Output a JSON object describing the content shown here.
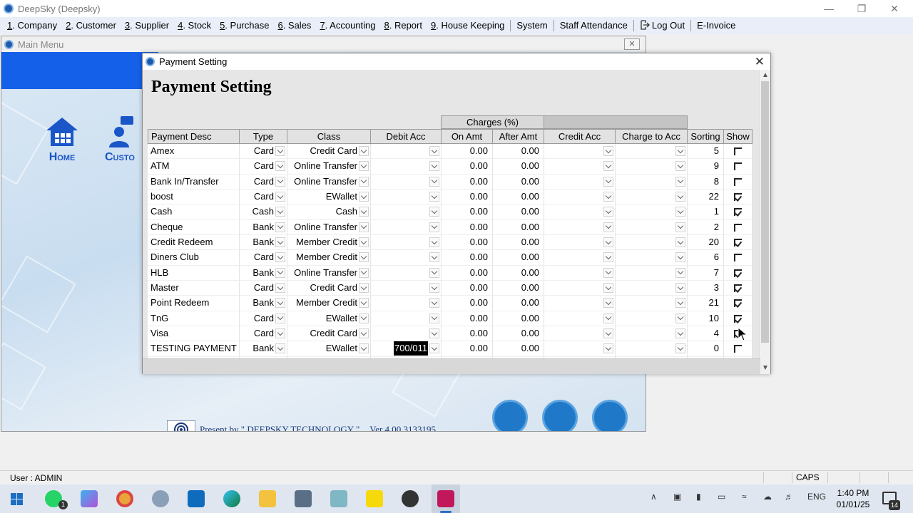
{
  "app": {
    "title": "DeepSky (Deepsky)"
  },
  "menu": {
    "items": [
      {
        "num": "1",
        "label": ". Company"
      },
      {
        "num": "2",
        "label": ". Customer"
      },
      {
        "num": "3",
        "label": ". Supplier"
      },
      {
        "num": "4",
        "label": ". Stock"
      },
      {
        "num": "5",
        "label": ". Purchase"
      },
      {
        "num": "6",
        "label": ". Sales"
      },
      {
        "num": "7",
        "label": ". Accounting"
      },
      {
        "num": "8",
        "label": ". Report"
      },
      {
        "num": "9",
        "label": ". House Keeping"
      }
    ],
    "system": "System",
    "staff_attendance": "Staff Attendance",
    "logout": "Log Out",
    "einvoice": "E-Invoice"
  },
  "main_menu": {
    "title": "Main Menu",
    "home_label": "Home",
    "customer_label": "Custo",
    "present_by": "Present by \" DEEPSKY TECHNOLOGY \"",
    "version": "Ver 4.00.3133195"
  },
  "payment_window": {
    "title": "Payment Setting",
    "heading": "Payment Setting",
    "group_header": "Charges (%)",
    "columns": [
      "Payment Desc",
      "Type",
      "Class",
      "Debit Acc",
      "On Amt",
      "After Amt",
      "Credit Acc",
      "Charge to Acc",
      "Sorting",
      "Show"
    ],
    "rows": [
      {
        "desc": "Amex",
        "type": "Card",
        "class": "Credit Card",
        "debit": "",
        "on_amt": "0.00",
        "after_amt": "0.00",
        "sorting": "5",
        "show": false
      },
      {
        "desc": "ATM",
        "type": "Card",
        "class": "Online Transfer",
        "debit": "",
        "on_amt": "0.00",
        "after_amt": "0.00",
        "sorting": "9",
        "show": false
      },
      {
        "desc": "Bank In/Transfer",
        "type": "Card",
        "class": "Online Transfer",
        "debit": "",
        "on_amt": "0.00",
        "after_amt": "0.00",
        "sorting": "8",
        "show": false
      },
      {
        "desc": "boost",
        "type": "Card",
        "class": "EWallet",
        "debit": "",
        "on_amt": "0.00",
        "after_amt": "0.00",
        "sorting": "22",
        "show": true
      },
      {
        "desc": "Cash",
        "type": "Cash",
        "class": "Cash",
        "debit": "",
        "on_amt": "0.00",
        "after_amt": "0.00",
        "sorting": "1",
        "show": true
      },
      {
        "desc": "Cheque",
        "type": "Bank",
        "class": "Online Transfer",
        "debit": "",
        "on_amt": "0.00",
        "after_amt": "0.00",
        "sorting": "2",
        "show": false
      },
      {
        "desc": "Credit Redeem",
        "type": "Bank",
        "class": "Member Credit",
        "debit": "",
        "on_amt": "0.00",
        "after_amt": "0.00",
        "sorting": "20",
        "show": true
      },
      {
        "desc": "Diners Club",
        "type": "Card",
        "class": "Member Credit",
        "debit": "",
        "on_amt": "0.00",
        "after_amt": "0.00",
        "sorting": "6",
        "show": false
      },
      {
        "desc": "HLB",
        "type": "Bank",
        "class": "Online Transfer",
        "debit": "",
        "on_amt": "0.00",
        "after_amt": "0.00",
        "sorting": "7",
        "show": true
      },
      {
        "desc": "Master",
        "type": "Card",
        "class": "Credit Card",
        "debit": "",
        "on_amt": "0.00",
        "after_amt": "0.00",
        "sorting": "3",
        "show": true
      },
      {
        "desc": "Point Redeem",
        "type": "Bank",
        "class": "Member Credit",
        "debit": "",
        "on_amt": "0.00",
        "after_amt": "0.00",
        "sorting": "21",
        "show": true
      },
      {
        "desc": "TnG",
        "type": "Card",
        "class": "EWallet",
        "debit": "",
        "on_amt": "0.00",
        "after_amt": "0.00",
        "sorting": "10",
        "show": true
      },
      {
        "desc": "Visa",
        "type": "Card",
        "class": "Credit Card",
        "debit": "",
        "on_amt": "0.00",
        "after_amt": "0.00",
        "sorting": "4",
        "show": true
      },
      {
        "desc": "TESTING PAYMENT",
        "type": "Bank",
        "class": "EWallet",
        "debit": "700/011",
        "on_amt": "0.00",
        "after_amt": "0.00",
        "sorting": "0",
        "show": false
      },
      {
        "desc": "",
        "type": "",
        "class": "",
        "debit": "",
        "on_amt": "0.00",
        "after_amt": "0.00",
        "sorting": "0",
        "show": "indeterminate"
      }
    ]
  },
  "statusbar": {
    "user": "User :  ADMIN",
    "caps": "CAPS"
  },
  "taskbar": {
    "whatsapp_badge": "1",
    "lang": "ENG",
    "time": "1:40 PM",
    "date": "01/01/25",
    "notifications": "14"
  },
  "colors": {
    "menu_bg": "#e9eef8",
    "banner": "#1560e8",
    "accent": "#2b6cc4"
  }
}
